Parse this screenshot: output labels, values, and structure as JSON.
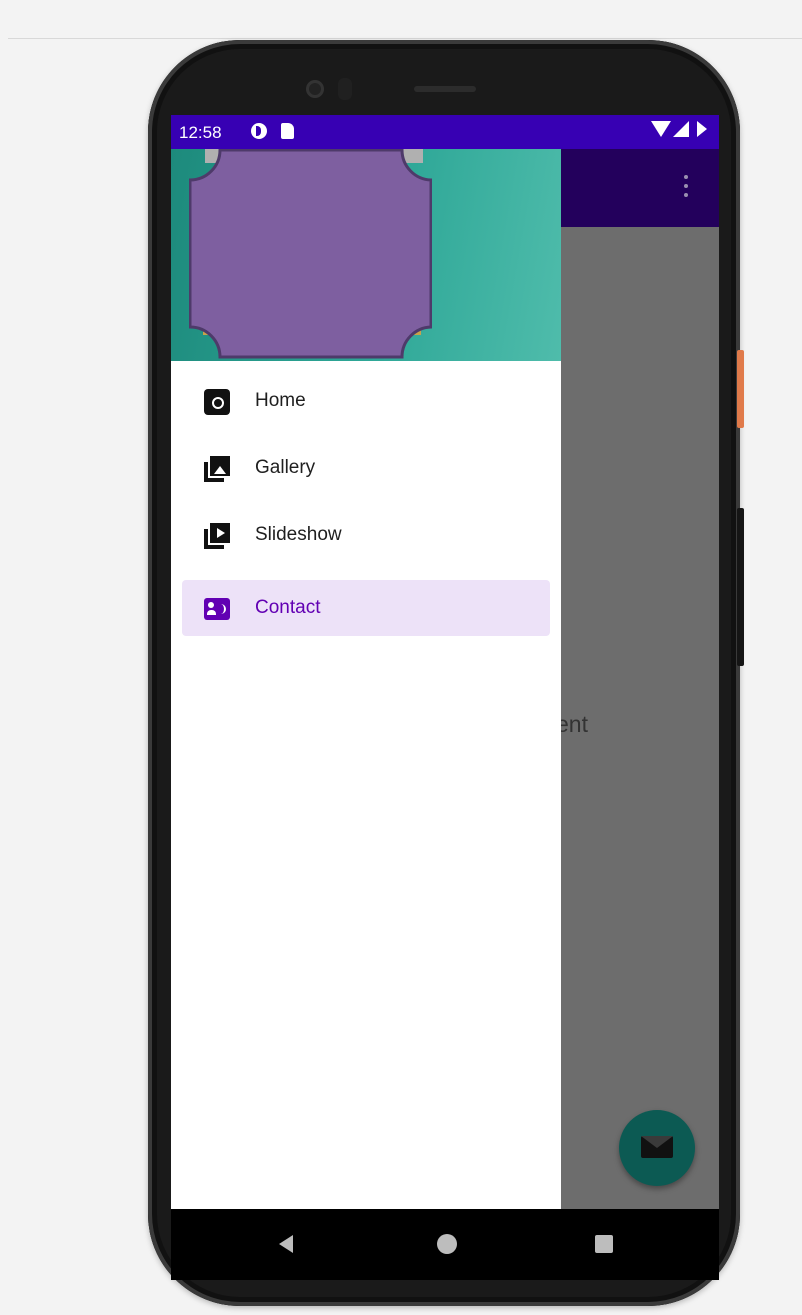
{
  "status_bar": {
    "time": "12:58",
    "icons": [
      "play-protect-icon",
      "sd-card-icon",
      "wifi-icon",
      "signal-icon",
      "battery-icon"
    ]
  },
  "app_bar": {
    "overflow_icon": "more-vertical-icon",
    "background": "#23005c"
  },
  "content": {
    "visible_text": "ent"
  },
  "fab": {
    "icon": "mail-icon",
    "color": "#0c5a53"
  },
  "drawer": {
    "header_image_color": "#7e5fa0",
    "header_gradient": [
      "#1d8a7c",
      "#4fbcab"
    ],
    "items": [
      {
        "label": "Home",
        "icon": "camera-icon",
        "selected": false
      },
      {
        "label": "Gallery",
        "icon": "gallery-icon",
        "selected": false
      },
      {
        "label": "Slideshow",
        "icon": "slideshow-icon",
        "selected": false
      },
      {
        "label": "Contact",
        "icon": "contact-icon",
        "selected": true
      }
    ],
    "selected_color": "#6200b3",
    "selected_background": "#ede2f8"
  },
  "navigation_bar": {
    "buttons": [
      "back-icon",
      "home-icon",
      "recents-icon"
    ]
  },
  "colors": {
    "status_bar": "#3700b3",
    "scrim": "#6d6d6d"
  }
}
